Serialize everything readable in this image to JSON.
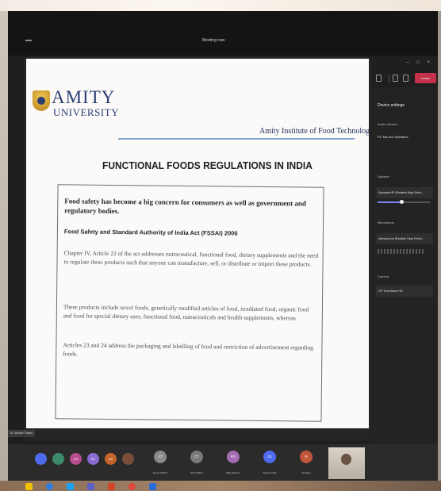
{
  "window": {
    "title": "Meeting now"
  },
  "toolbar": {
    "request_control": "Request control",
    "leave_label": "Leave",
    "colors": {
      "leave": "#c4314b",
      "background": "#1f1f1f"
    }
  },
  "slide": {
    "logo_name": "AMITY",
    "logo_sub": "UNIVERSITY",
    "institute": "Amity Institute of Food Technology",
    "title": "FUNCTIONAL FOODS  REGULATIONS IN INDIA",
    "lead": "Food safety has become a big concern  for consumers as well as government and regulatory bodies.",
    "act": "Food Safety and Standard Authority of India Act (FSSAI) 2006",
    "paragraphs": [
      "Chapter IV, Article 22 of the act addresses nutraceutical, functional food, dietary supplements and the need to regulate these products such that anyone can manufacture, sell, or distribute or import these products.",
      "These products include novel foods, genetically modified articles of food, irradiated food, organic food and food for special dietary uses, functional food, nutraceuticals and health supplements, whereas",
      "Articles 23 and 24 address the packaging and labelling of food and restriction of advertisement regarding foods."
    ]
  },
  "presenter": {
    "label": "Dr. Moushi Thakur"
  },
  "settings": {
    "title": "Device settings",
    "audio_label": "Audio devices",
    "audio_value": "PC Mic and Speakers",
    "speaker_label": "Speaker",
    "speaker_value": "Speaker/HP (Realtek High Defin...",
    "speaker_volume": 0.45,
    "mic_label": "Microphone",
    "mic_value": "Microphone (Realtek High Defini...",
    "camera_label": "Camera",
    "camera_value": "HP TrueVision HD",
    "accent": "#7f85f5"
  },
  "participants": {
    "small": [
      {
        "initials": "",
        "color": "#4f6bed"
      },
      {
        "initials": "",
        "color": "#3c8b6b"
      },
      {
        "initials": "DS",
        "color": "#b54d8f"
      },
      {
        "initials": "SC",
        "color": "#8c6bd1"
      },
      {
        "initials": "AS",
        "color": "#c4642a"
      },
      {
        "initials": "",
        "color": "#7a4f3a"
      }
    ],
    "tiles": [
      {
        "initials": "AT",
        "name": "Ameer Rathur",
        "color": "#8a8a8a"
      },
      {
        "initials": "CT",
        "name": "Sruti Rathur",
        "color": "#7a7a7a"
      },
      {
        "initials": "RS",
        "name": "Raju Sharma",
        "color": "#a36bb0"
      },
      {
        "initials": "SJ",
        "name": "Sneha Joshi",
        "color": "#4f6bed"
      },
      {
        "initials": "N",
        "name": "sandeep",
        "color": "#c0563b"
      }
    ]
  }
}
